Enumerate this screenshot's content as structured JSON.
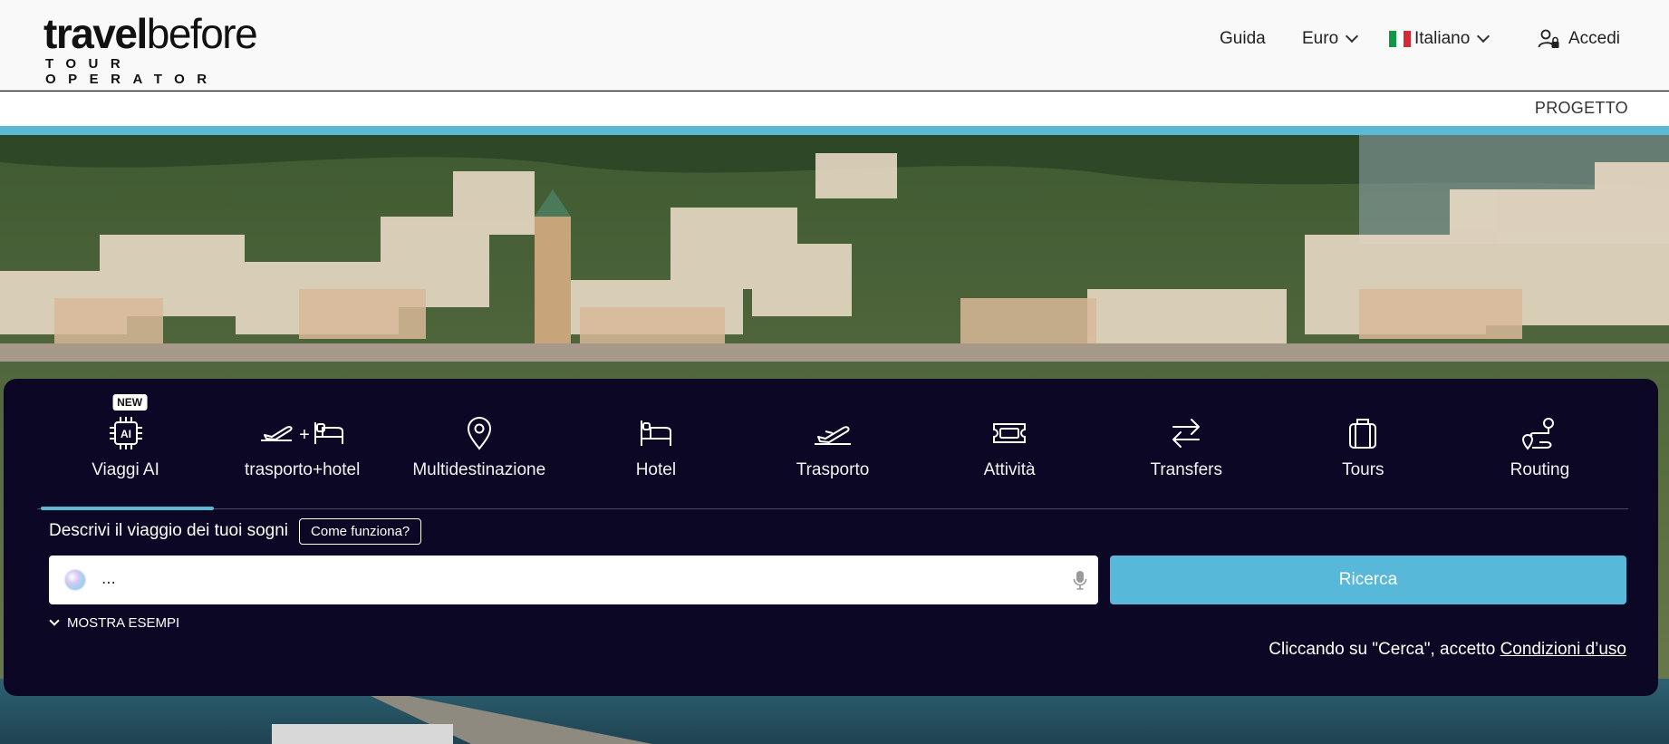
{
  "header": {
    "logo": {
      "word1": "travel",
      "word2": "before",
      "sub": "TOUR OPERATOR"
    },
    "nav": {
      "guide": "Guida",
      "currency": "Euro",
      "language": "Italiano",
      "login": "Accedi"
    },
    "subnav": {
      "project": "PROGETTO"
    }
  },
  "colors": {
    "accent": "#5cb9d6",
    "panel": "#0c0724",
    "search_button": "#58b8d9"
  },
  "search": {
    "tabs": [
      {
        "label": "Viaggi AI",
        "icon": "ai-chip-icon",
        "badge": "NEW",
        "active": true
      },
      {
        "label": "trasporto+hotel",
        "icon": "plane-plus-bed-icon",
        "active": false
      },
      {
        "label": "Multidestinazione",
        "icon": "map-pin-icon",
        "active": false
      },
      {
        "label": "Hotel",
        "icon": "bed-icon",
        "active": false
      },
      {
        "label": "Trasporto",
        "icon": "plane-icon",
        "active": false
      },
      {
        "label": "Attività",
        "icon": "ticket-icon",
        "active": false
      },
      {
        "label": "Transfers",
        "icon": "swap-arrows-icon",
        "active": false
      },
      {
        "label": "Tours",
        "icon": "suitcase-icon",
        "active": false
      },
      {
        "label": "Routing",
        "icon": "route-icon",
        "active": false
      }
    ],
    "prompt_label": "Descrivi il viaggio dei tuoi sogni",
    "how_button": "Come funziona?",
    "input_value": "...",
    "submit_label": "Ricerca",
    "show_examples": "MOSTRA ESEMPI",
    "terms_prefix": "Cliccando su \"Cerca\", accetto",
    "terms_link": "Condizioni d’uso"
  }
}
